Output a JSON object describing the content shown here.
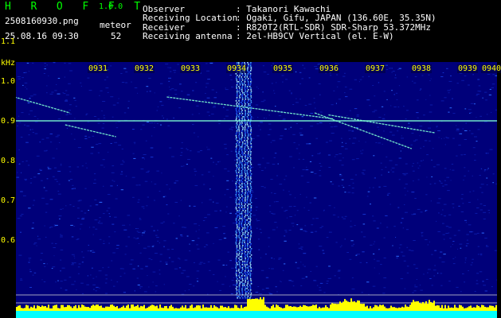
{
  "header": {
    "app_name": "H R O F F T",
    "version": "1.0.0",
    "filename": "2508160930.png",
    "datetime": "25.08.16 09:30",
    "meteor_label": "meteor",
    "meteor_count": "52",
    "info": [
      {
        "label": "Observer",
        "value": ": Takanori Kawachi"
      },
      {
        "label": "Receiving Location",
        "value": ": Ogaki, Gifu, JAPAN (136.60E, 35.35N)"
      },
      {
        "label": "Receiver",
        "value": ": R820T2(RTL-SDR) SDR-Sharp 53.372MHz"
      },
      {
        "label": "Receiving antenna",
        "value": ": 2el-HB9CV Vertical (el. E-W)"
      }
    ]
  },
  "colors": {
    "background": "#000000",
    "spectrogram_bg": "#00007a",
    "label_yellow": "#ffff00",
    "title_green": "#00ff00",
    "signal_cyan": "#7fffd4",
    "level_yellow": "#ffff00",
    "level_cyan": "#00ffff"
  },
  "chart_data": {
    "type": "heatmap",
    "ylabel": "kHz",
    "yticks": [
      "1.1",
      "1.0",
      "0.9",
      "0.8",
      "0.7",
      "0.6"
    ],
    "ylim": [
      0.58,
      1.2
    ],
    "xticks": [
      "0931",
      "0932",
      "0933",
      "0934",
      "0935",
      "0936",
      "0937",
      "0938",
      "0939",
      "0940"
    ],
    "xlim": [
      930,
      940
    ],
    "carrier_khz": 0.9,
    "broadband_interference_minutes": [
      934.8,
      935.1
    ],
    "meteor_traces": [
      {
        "x": [
          930.0,
          931.2
        ],
        "y": [
          0.96,
          0.92
        ]
      },
      {
        "x": [
          931.1,
          932.2
        ],
        "y": [
          0.89,
          0.86
        ]
      },
      {
        "x": [
          933.3,
          936.9
        ],
        "y": [
          0.96,
          0.905
        ]
      },
      {
        "x": [
          936.5,
          938.6
        ],
        "y": [
          0.92,
          0.83
        ]
      },
      {
        "x": [
          936.8,
          939.1
        ],
        "y": [
          0.915,
          0.87
        ]
      }
    ],
    "grid": false
  }
}
